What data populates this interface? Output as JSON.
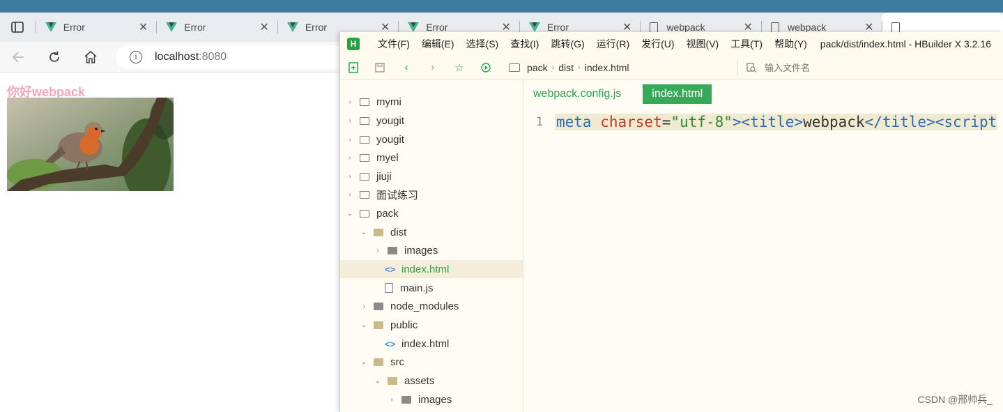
{
  "browser": {
    "tabs": [
      {
        "label": "Error",
        "icon": "vue-icon"
      },
      {
        "label": "Error",
        "icon": "vue-icon"
      },
      {
        "label": "Error",
        "icon": "vue-icon"
      },
      {
        "label": "Error",
        "icon": "vue-icon"
      },
      {
        "label": "Error",
        "icon": "vue-icon"
      },
      {
        "label": "webpack",
        "icon": "document-icon"
      },
      {
        "label": "webpack",
        "icon": "document-icon"
      }
    ],
    "url_host": "localhost",
    "url_port": ":8080"
  },
  "page": {
    "heading": "你好webpack",
    "image": "robin-bird-photo"
  },
  "hbuilder": {
    "logo": "H",
    "menu": [
      "文件(F)",
      "编辑(E)",
      "选择(S)",
      "查找(I)",
      "跳转(G)",
      "运行(R)",
      "发行(U)",
      "视图(V)",
      "工具(T)",
      "帮助(Y)"
    ],
    "title": "pack/dist/index.html - HBuilder X 3.2.16",
    "breadcrumb": [
      "pack",
      "dist",
      "index.html"
    ],
    "file_search_placeholder": "输入文件名",
    "tree": [
      {
        "label": "mymi"
      },
      {
        "label": "yougit"
      },
      {
        "label": "yougit"
      },
      {
        "label": "myel"
      },
      {
        "label": "jiuji"
      },
      {
        "label": "面试练习"
      },
      {
        "label": "pack"
      },
      {
        "label": "dist"
      },
      {
        "label": "images"
      },
      {
        "label": "index.html"
      },
      {
        "label": "main.js"
      },
      {
        "label": "node_modules"
      },
      {
        "label": "public"
      },
      {
        "label": "index.html"
      },
      {
        "label": "src"
      },
      {
        "label": "assets"
      },
      {
        "label": "images"
      }
    ],
    "editor_tabs": [
      "webpack.config.js",
      "index.html"
    ],
    "line_number": "1",
    "code": {
      "t1": "meta ",
      "t2": "charset",
      "t3": "=",
      "t4": "\"utf-8\"",
      "t5": "><title>",
      "t6": "webpack",
      "t7": "</title><script"
    }
  },
  "watermark": "CSDN @邢帅兵_",
  "colors": {
    "accent": "#2aa44f",
    "topbar": "#3d7ba0",
    "heading": "#f4a6b8"
  }
}
